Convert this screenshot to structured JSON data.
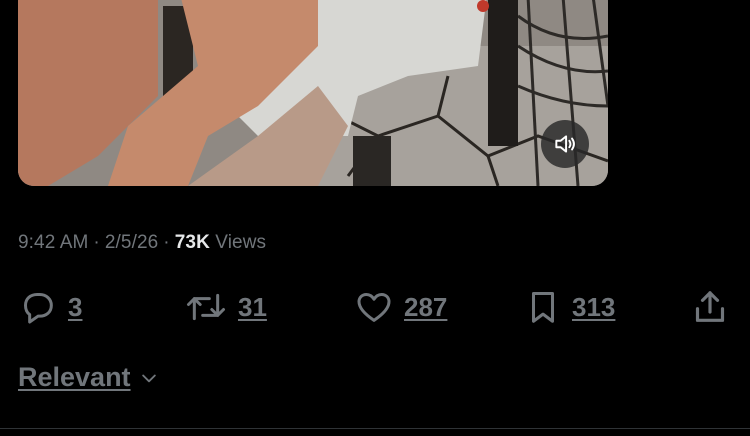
{
  "post": {
    "time": "9:42 AM",
    "date": "2/5/26",
    "views_count": "73K",
    "views_label": "Views"
  },
  "actions": {
    "replies": "3",
    "reposts": "31",
    "likes": "287",
    "bookmarks": "313"
  },
  "replies_sort": {
    "label": "Relevant"
  },
  "icons": {
    "reply": "speech-bubble-icon",
    "repost": "repost-arrows-icon",
    "like": "heart-icon",
    "bookmark": "bookmark-icon",
    "share": "share-upload-icon",
    "mute": "speaker-muted-icon",
    "chevron": "chevron-down-icon"
  },
  "colors": {
    "background": "#000000",
    "primary_text": "#e7e9ea",
    "secondary_text": "#71767b"
  }
}
